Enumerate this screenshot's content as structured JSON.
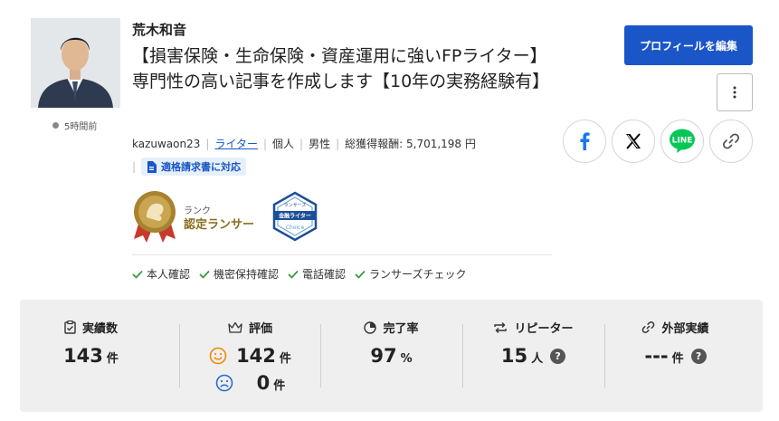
{
  "profile": {
    "name": "荒木和音",
    "catchphrase": "【損害保険・生命保険・資産運用に強いFPライター】専門性の高い記事を作成します【10年の実務経験有】",
    "status_time": "5時間前",
    "username": "kazuwaon23",
    "role_link": "ライター",
    "type": "個人",
    "gender": "男性",
    "total_reward": "総獲得報酬: 5,701,198 円",
    "invoice_badge": "適格請求書に対応",
    "rank_label": "ランク",
    "rank_name": "認定ランサー",
    "choice_badge_top": "ランサーズ",
    "choice_badge_mid": "金融ライター",
    "choice_badge_bottom": "Choice"
  },
  "verifications": [
    {
      "label": "本人確認"
    },
    {
      "label": "機密保持確認"
    },
    {
      "label": "電話確認"
    },
    {
      "label": "ランサーズチェック"
    }
  ],
  "actions": {
    "profile_edit": "プロフィールを編集",
    "more_icon": "kebab-vertical-icon",
    "share": [
      {
        "name": "facebook",
        "color": "#1877f2"
      },
      {
        "name": "x",
        "color": "#000000"
      },
      {
        "name": "line",
        "label": "LINE",
        "color": "#06c755"
      },
      {
        "name": "link",
        "color": "#555555"
      }
    ]
  },
  "stats": {
    "achievements": {
      "label": "実績数",
      "value": "143",
      "unit": "件"
    },
    "rating": {
      "label": "評価",
      "good_value": "142",
      "good_unit": "件",
      "bad_value": "0",
      "bad_unit": "件",
      "good_color": "#f08a00",
      "bad_color": "#2a6dd4"
    },
    "completion": {
      "label": "完了率",
      "value": "97",
      "unit": "%"
    },
    "repeaters": {
      "label": "リピーター",
      "value": "15",
      "unit": "人",
      "help": "?"
    },
    "external": {
      "label": "外部実績",
      "value": "---",
      "unit": "件",
      "help": "?"
    }
  }
}
